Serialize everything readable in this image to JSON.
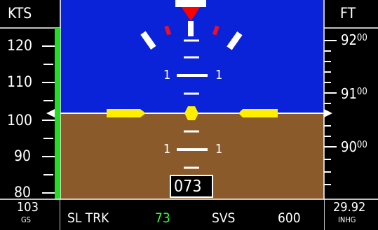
{
  "airspeed": {
    "unit": "KTS",
    "ticks": [
      "120",
      "110",
      "100",
      "90",
      "80"
    ],
    "ground_speed": "103",
    "ground_speed_label": "GS"
  },
  "altitude": {
    "unit": "FT",
    "ticks": [
      {
        "main": "92",
        "sup": "00"
      },
      {
        "main": "91",
        "sup": "00"
      },
      {
        "main": "90",
        "sup": "00"
      }
    ],
    "baro": "29.92",
    "baro_label": "INHG"
  },
  "attitude": {
    "pitch_labels": [
      "1",
      "1",
      "1",
      "1"
    ],
    "heading": "073"
  },
  "status_bar": {
    "mode_label": "SL TRK",
    "mode_value": "73",
    "svs_label": "SVS",
    "svs_value": "600"
  },
  "colors": {
    "sky": "#0A22D8",
    "ground": "#8B5A2B",
    "speed_band": "#22DD22",
    "reference_symbol": "#FFEE00",
    "bank_pointer": "#FF0000",
    "mode_value": "#33FF33"
  }
}
